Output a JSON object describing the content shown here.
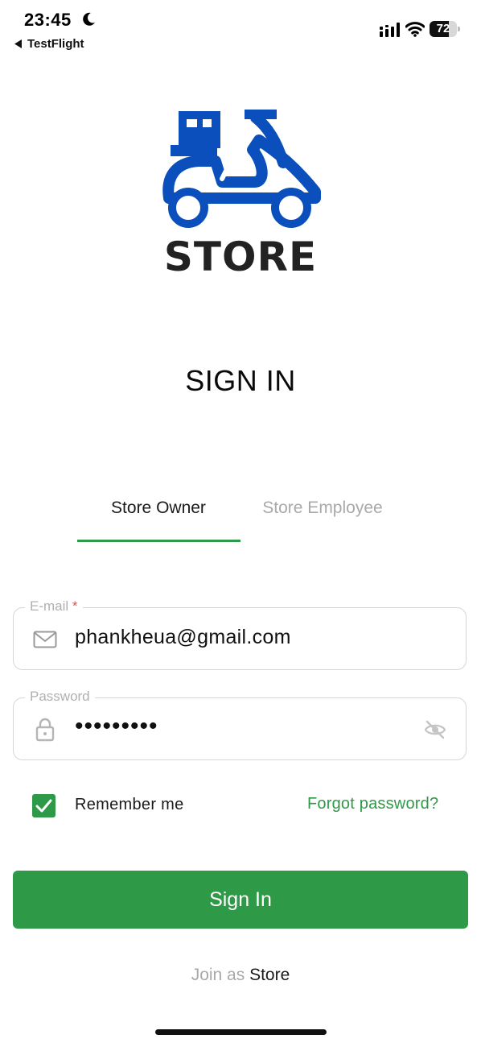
{
  "status_bar": {
    "time": "23:45",
    "back_app": "TestFlight",
    "battery": "72",
    "battery_level": 0.72
  },
  "logo": {
    "wordmark": "STORE",
    "brand_color": "#0b4fbc"
  },
  "page_title": "SIGN IN",
  "tabs": [
    {
      "label": "Store Owner",
      "active": true
    },
    {
      "label": "Store Employee",
      "active": false
    }
  ],
  "form": {
    "email": {
      "label": "E-mail",
      "required_mark": "*",
      "value": "phankheua@gmail.com",
      "icon": "mail-icon"
    },
    "password": {
      "label": "Password",
      "value": "•••••••••",
      "icon": "lock-icon",
      "toggle_icon": "eye-off-icon"
    },
    "remember_me": {
      "label": "Remember me",
      "checked": true
    },
    "forgot_password": "Forgot password?",
    "submit": "Sign In"
  },
  "footer": {
    "join_prefix": "Join as",
    "join_link": "Store"
  },
  "colors": {
    "accent": "#2e9a47",
    "muted_text": "#a9a9a9",
    "required": "#e25353"
  }
}
